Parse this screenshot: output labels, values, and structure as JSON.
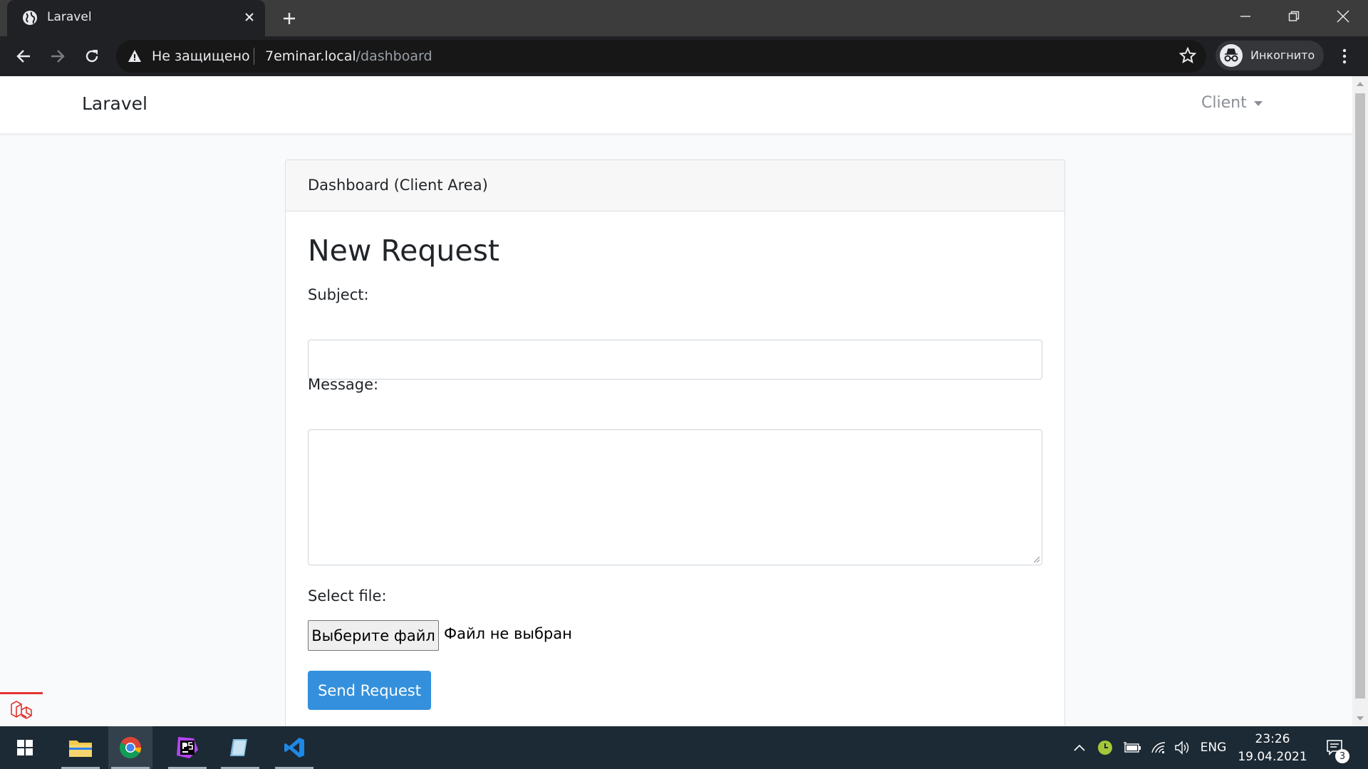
{
  "browser": {
    "tab_title": "Laravel",
    "security_label": "Не защищено",
    "url_host": "7eminar.local",
    "url_path": "/dashboard",
    "incognito_label": "Инкогнито"
  },
  "navbar": {
    "brand": "Laravel",
    "user_dropdown": "Client"
  },
  "card": {
    "header": "Dashboard (Client Area)",
    "heading": "New Request",
    "subject_label": "Subject:",
    "subject_value": "",
    "message_label": "Message:",
    "message_value": "",
    "file_label": "Select file:",
    "file_button": "Выберите файл",
    "file_status": "Файл не выбран",
    "submit": "Send Request"
  },
  "taskbar": {
    "language": "ENG",
    "time": "23:26",
    "date": "19.04.2021",
    "notification_count": "3"
  },
  "colors": {
    "primary": "#3490dc",
    "page_bg": "#f8fafc",
    "taskbar_bg": "#1c2a35"
  }
}
